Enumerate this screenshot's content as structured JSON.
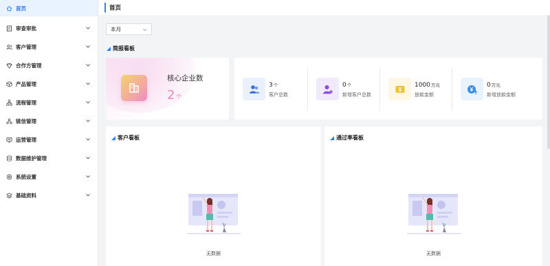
{
  "sidebar": {
    "items": [
      {
        "label": "首页",
        "icon": "home-icon",
        "active": true,
        "expandable": false
      },
      {
        "label": "审查审批",
        "icon": "audit-icon",
        "active": false,
        "expandable": true
      },
      {
        "label": "客户管理",
        "icon": "users-icon",
        "active": false,
        "expandable": true
      },
      {
        "label": "合作方管理",
        "icon": "diamond-icon",
        "active": false,
        "expandable": true
      },
      {
        "label": "产品管理",
        "icon": "box-icon",
        "active": false,
        "expandable": true
      },
      {
        "label": "流程管理",
        "icon": "flow-icon",
        "active": false,
        "expandable": true
      },
      {
        "label": "链信管理",
        "icon": "chain-icon",
        "active": false,
        "expandable": true
      },
      {
        "label": "运营管理",
        "icon": "monitor-icon",
        "active": false,
        "expandable": true
      },
      {
        "label": "数据维护管理",
        "icon": "database-icon",
        "active": false,
        "expandable": true
      },
      {
        "label": "系统设置",
        "icon": "settings-icon",
        "active": false,
        "expandable": true
      },
      {
        "label": "基础资料",
        "icon": "layers-icon",
        "active": false,
        "expandable": true
      }
    ]
  },
  "header": {
    "title": "首页"
  },
  "filter": {
    "period_value": "本月"
  },
  "brief": {
    "title": "简报看板"
  },
  "core": {
    "title": "核心企业数",
    "value": "2",
    "unit": "个"
  },
  "stats": [
    {
      "value": "3",
      "unit": "个",
      "label": "客户总数",
      "icon": "users-icon",
      "color": "#3a6fd8",
      "bg": "#eaf1fd"
    },
    {
      "value": "0",
      "unit": "个",
      "label": "新增客户总数",
      "icon": "user-add-icon",
      "color": "#8a4fd8",
      "bg": "#f1eafc"
    },
    {
      "value": "1000",
      "unit": "万元",
      "label": "放款金额",
      "icon": "yen-icon",
      "color": "#f1c232",
      "bg": "#fdf7e3"
    },
    {
      "value": "0",
      "unit": "万元",
      "label": "新增放款金额",
      "icon": "yen-up-icon",
      "color": "#3a8de8",
      "bg": "#e8f3fd"
    }
  ],
  "panels": {
    "customer": {
      "title": "客户看板",
      "empty_text": "无数据"
    },
    "pass_rate": {
      "title": "通过率看板",
      "empty_text": "无数据"
    }
  },
  "colors": {
    "accent": "#2f7ef7",
    "pink": "#ec86bd"
  }
}
